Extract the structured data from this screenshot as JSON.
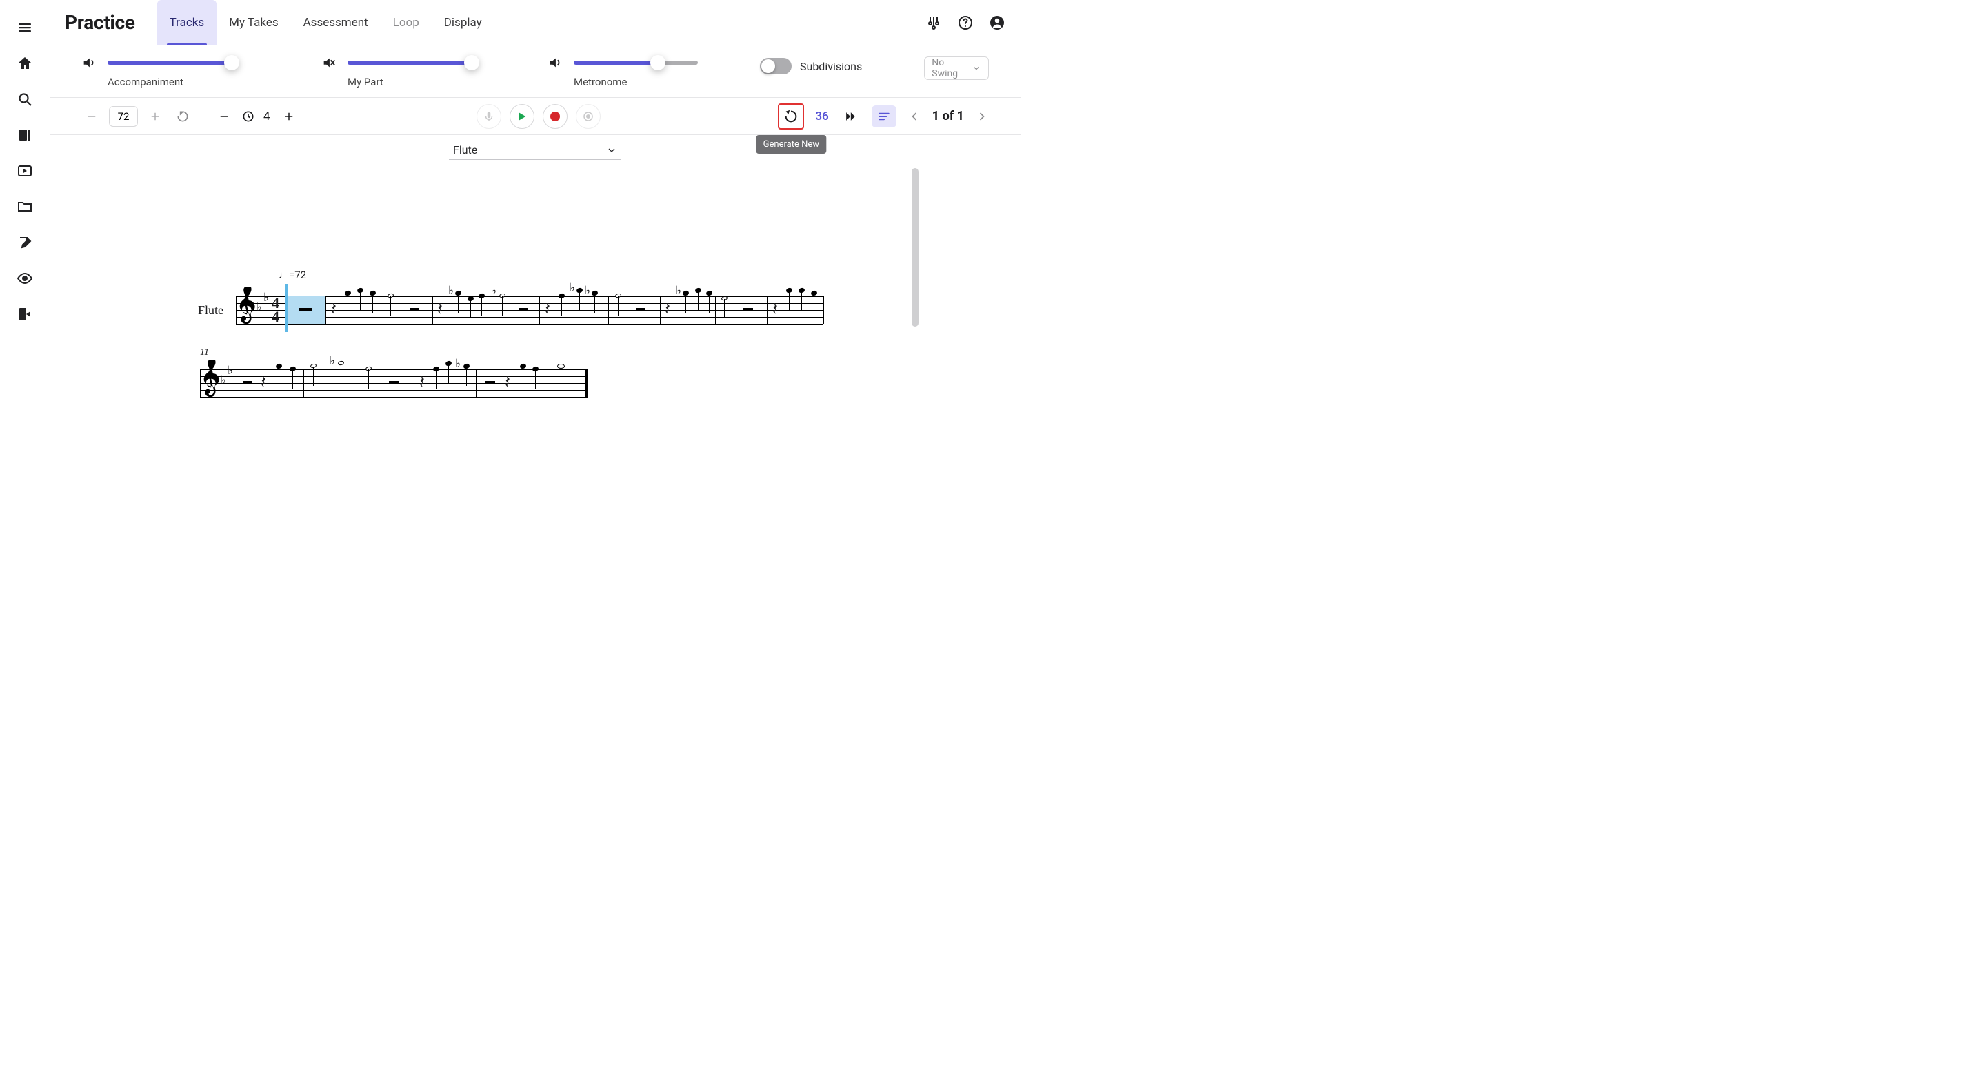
{
  "app": {
    "title": "Practice"
  },
  "tabs": [
    {
      "id": "tracks",
      "label": "Tracks",
      "active": true,
      "disabled": false
    },
    {
      "id": "mytakes",
      "label": "My Takes",
      "active": false,
      "disabled": false
    },
    {
      "id": "assessment",
      "label": "Assessment",
      "active": false,
      "disabled": false
    },
    {
      "id": "loop",
      "label": "Loop",
      "active": false,
      "disabled": true
    },
    {
      "id": "display",
      "label": "Display",
      "active": false,
      "disabled": false
    }
  ],
  "sliders": {
    "accompaniment": {
      "label": "Accompaniment",
      "muted": false,
      "value": 100
    },
    "mypart": {
      "label": "My Part",
      "muted": true,
      "value": 100
    },
    "metronome": {
      "label": "Metronome",
      "muted": false,
      "value": 68
    }
  },
  "subdivisions_label": "Subdivisions",
  "swing_label": "No Swing",
  "toolbar": {
    "tempo": "72",
    "count_in": "4",
    "generate_tooltip": "Generate New",
    "bar_count": "36",
    "page_text": "1 of 1"
  },
  "instrument": {
    "selected": "Flute"
  },
  "score": {
    "part_name": "Flute",
    "tempo_marking": "♩=72",
    "time_sig": {
      "num": "4",
      "den": "4"
    },
    "system2_start_measure": "11",
    "playback_measure": 1
  }
}
